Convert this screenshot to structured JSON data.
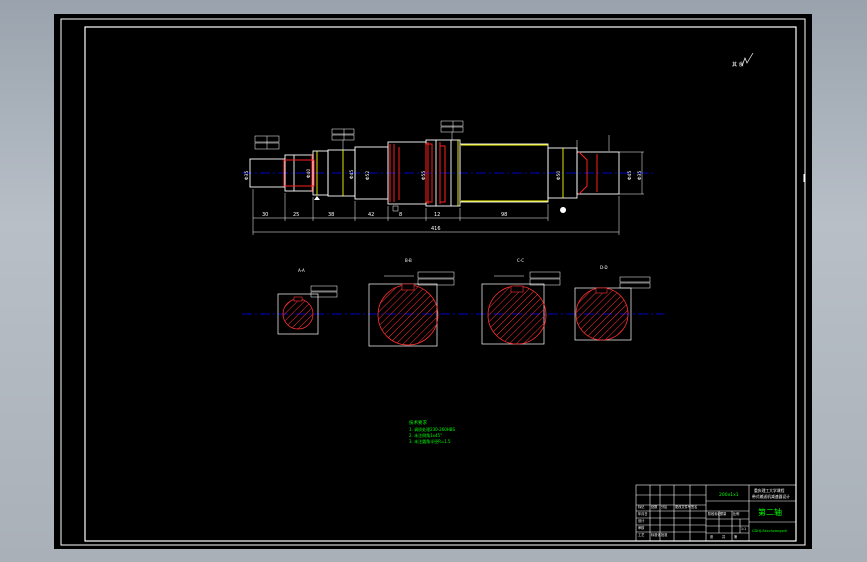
{
  "drawing": {
    "corner_mark": "其 余",
    "overall_length": "416",
    "segment_dims": [
      "30",
      "25",
      "38",
      "42",
      "8",
      "12",
      "98"
    ],
    "dia_labels_left": [
      "Φ35",
      "Φ40",
      "Φ45",
      "Φ52",
      "Φ55"
    ],
    "dia_labels_right": [
      "Φ50",
      "Φ45",
      "Φ35"
    ],
    "section_labels": [
      "A-A",
      "B-B",
      "C-C",
      "D-D"
    ],
    "tech_requirements": {
      "title": "技术要求",
      "items": [
        "1. 调质处理230-260HBS",
        "2. 未注倒角1x45°",
        "3. 未注圆角半径R=1.5"
      ]
    },
    "title_block": {
      "scale_text": "200x1x1",
      "school_line1": "重庆理工大学课程",
      "school_line2": "带式输送机减速器设计",
      "part_name": "第二轴",
      "drawing_no": "CDHJ-Secchzongzdi",
      "cell_labels": [
        "标记",
        "处数",
        "分区",
        "更改文件号",
        "签名",
        "年月日",
        "设计",
        "审核",
        "工艺",
        "标准化",
        "批准",
        "阶段标记",
        "重量",
        "比例"
      ],
      "bottom_left": [
        "张",
        "共",
        "第"
      ],
      "bottom_right": [
        "1:1"
      ]
    }
  }
}
